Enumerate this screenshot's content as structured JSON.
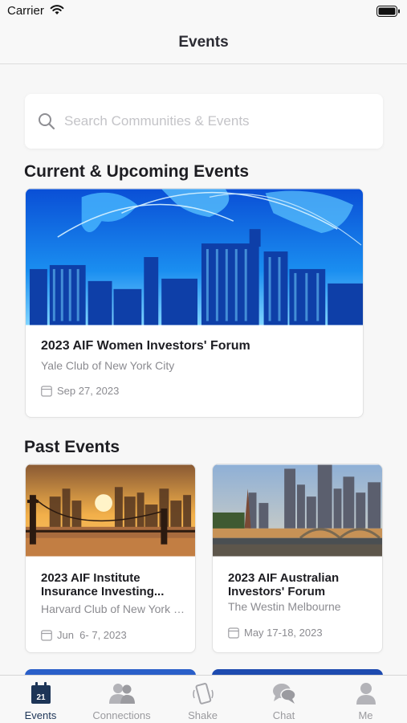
{
  "status_bar": {
    "carrier": "Carrier"
  },
  "nav": {
    "title": "Events"
  },
  "search": {
    "placeholder": "Search Communities & Events"
  },
  "sections": {
    "current": "Current & Upcoming Events",
    "past": "Past Events"
  },
  "current_events": [
    {
      "title": "2023 AIF Women Investors' Forum",
      "venue": "Yale Club of New York City",
      "date": "Sep 27, 2023"
    }
  ],
  "past_events": [
    {
      "title": "2023 AIF Institute Insurance Investing...",
      "venue": "Harvard Club of New York C...",
      "date": "Jun  6- 7, 2023"
    },
    {
      "title": "2023 AIF Australian Investors' Forum",
      "venue": "The Westin Melbourne",
      "date": "May 17-18, 2023"
    }
  ],
  "tabs": [
    {
      "label": "Events",
      "icon": "calendar-icon",
      "active": true,
      "badge": "21"
    },
    {
      "label": "Connections",
      "icon": "people-icon",
      "active": false
    },
    {
      "label": "Shake",
      "icon": "phone-shake-icon",
      "active": false
    },
    {
      "label": "Chat",
      "icon": "chat-bubbles-icon",
      "active": false
    },
    {
      "label": "Me",
      "icon": "person-icon",
      "active": false
    }
  ],
  "colors": {
    "accent": "#1d3557",
    "muted": "#9a9a9e",
    "background": "#f7f7f7"
  }
}
